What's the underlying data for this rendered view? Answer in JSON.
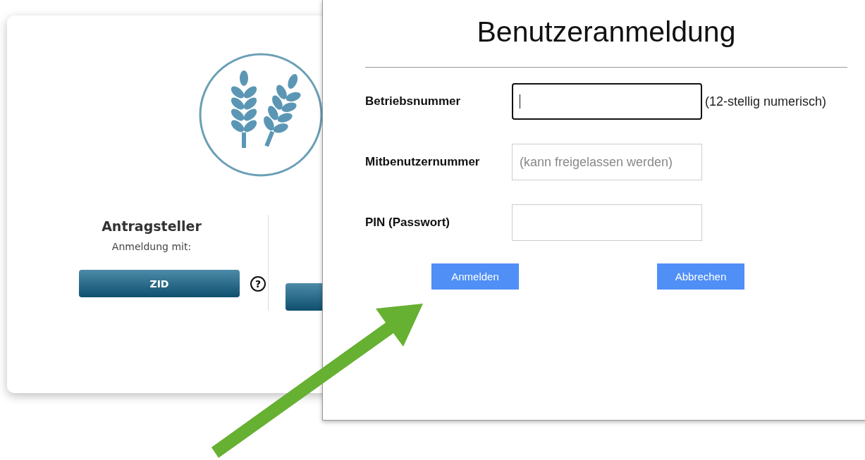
{
  "card": {
    "title": "Antragsteller",
    "subtitle": "Anmeldung mit:",
    "button": "ZID",
    "help": "?"
  },
  "dialog": {
    "title": "Benutzeranmeldung",
    "fields": [
      {
        "label": "Betriebsnummer",
        "focused": true,
        "hint": "(12-stellig numerisch)"
      },
      {
        "label": "Mitbenutzernummer",
        "focused": false,
        "placeholder": "(kann freigelassen werden)"
      },
      {
        "label": "PIN (Passwort)",
        "focused": false
      }
    ],
    "buttons": [
      "Anmelden",
      "Abbrechen"
    ]
  }
}
